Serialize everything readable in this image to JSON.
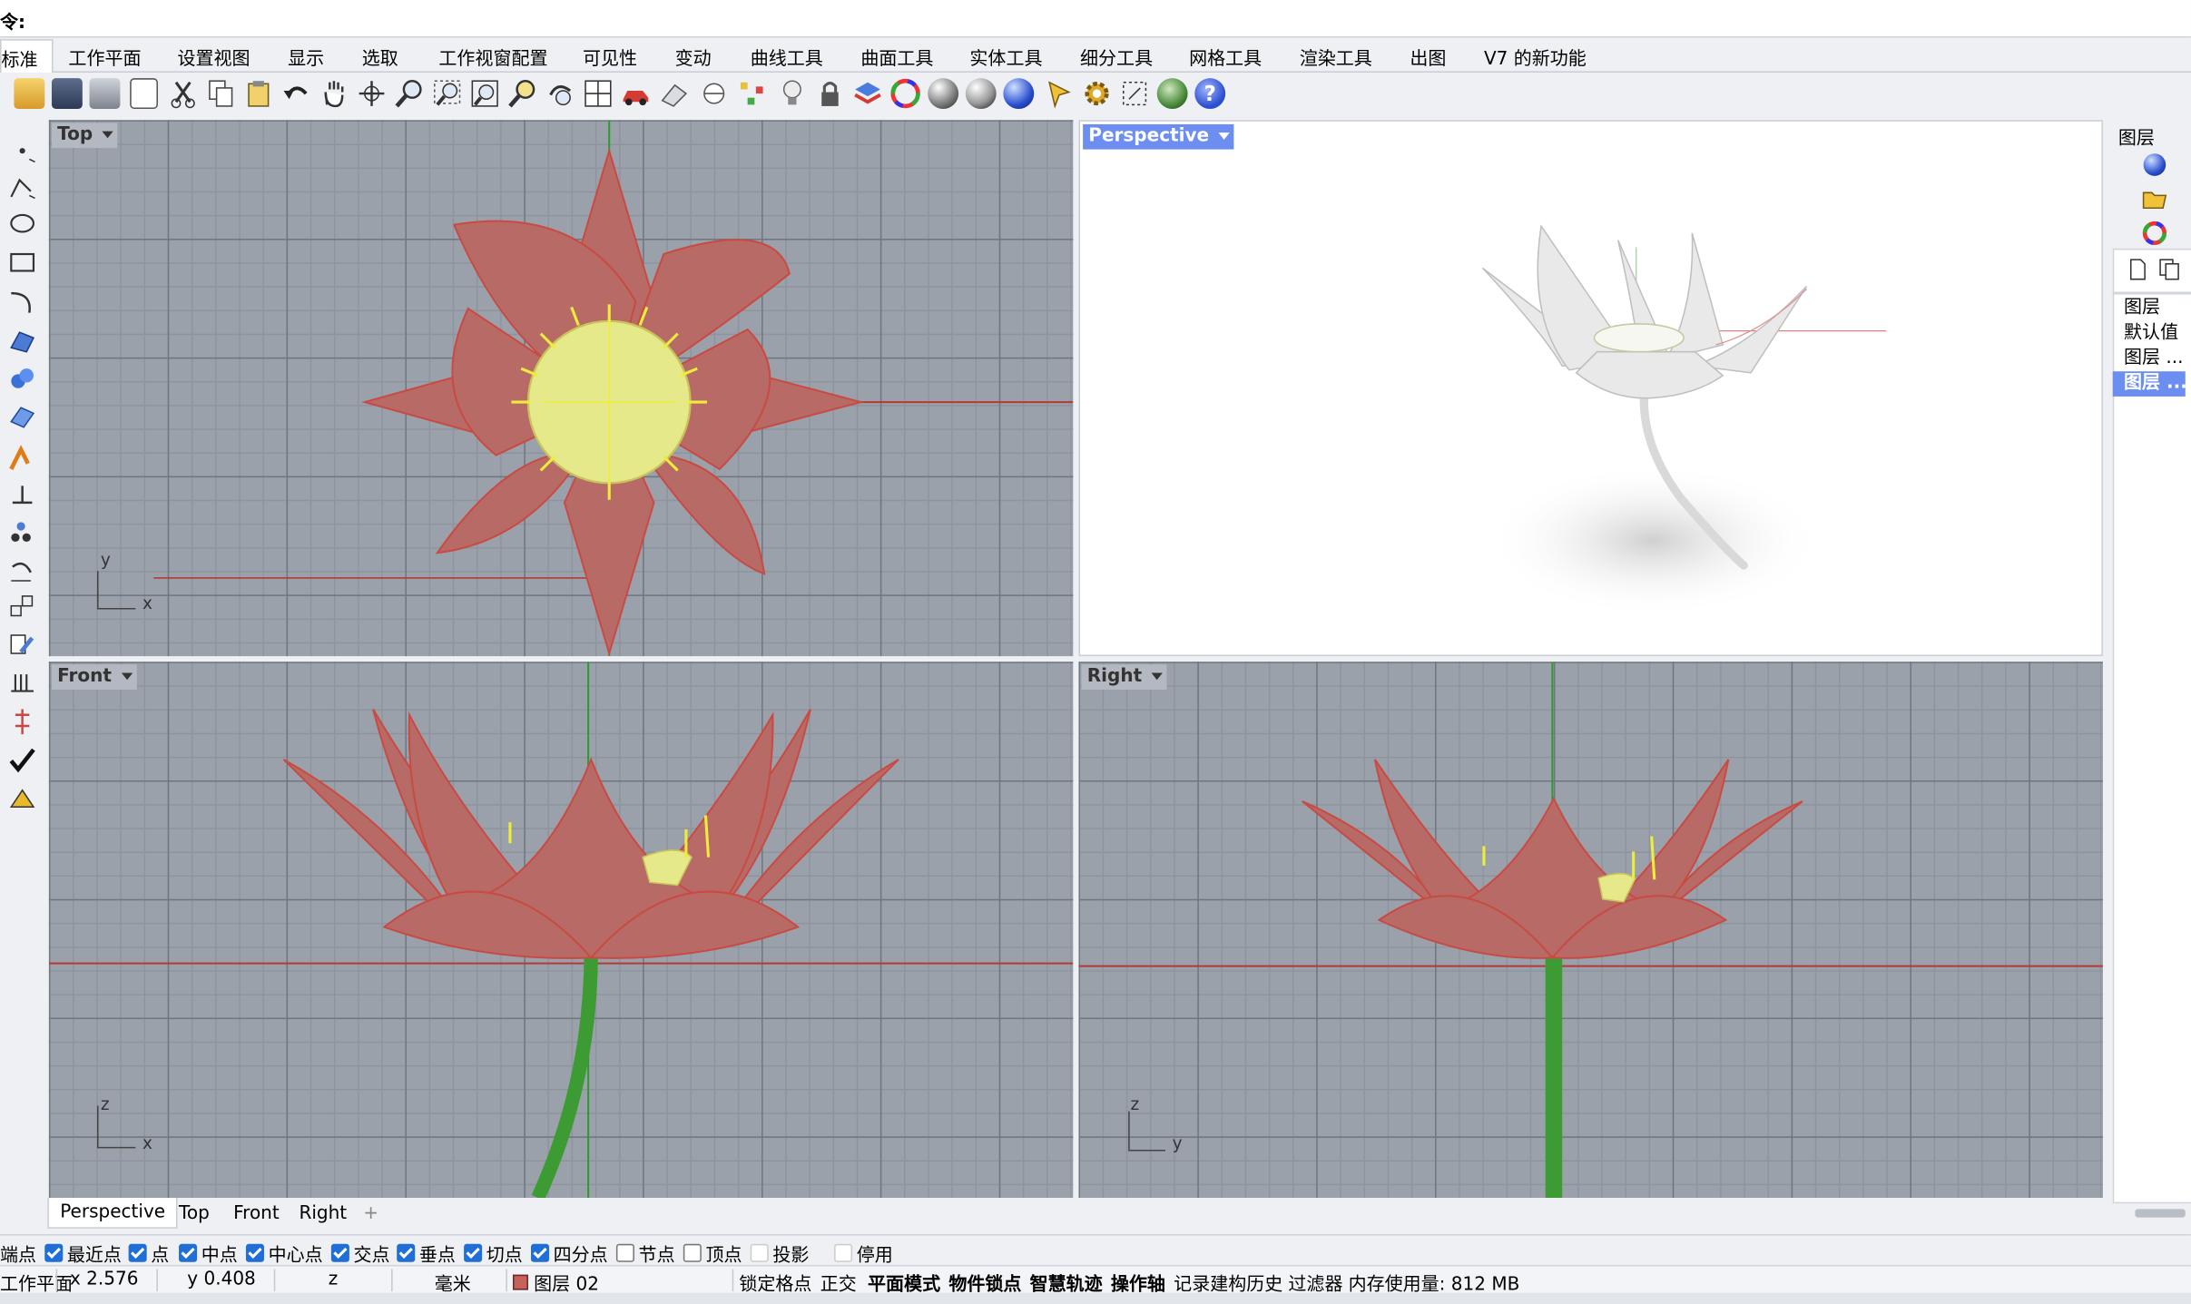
{
  "command": {
    "prompt": "令:"
  },
  "menu_tabs": [
    {
      "label": "标准",
      "active": true
    },
    {
      "label": "工作平面"
    },
    {
      "label": "设置视图"
    },
    {
      "label": "显示"
    },
    {
      "label": "选取"
    },
    {
      "label": "工作视窗配置"
    },
    {
      "label": "可见性"
    },
    {
      "label": "变动"
    },
    {
      "label": "曲线工具"
    },
    {
      "label": "曲面工具"
    },
    {
      "label": "实体工具"
    },
    {
      "label": "细分工具"
    },
    {
      "label": "网格工具"
    },
    {
      "label": "渲染工具"
    },
    {
      "label": "出图"
    },
    {
      "label": "V7 的新功能"
    }
  ],
  "viewports": {
    "top": {
      "title": "Top",
      "axis_v": "y",
      "axis_h": "x"
    },
    "perspective": {
      "title": "Perspective"
    },
    "front": {
      "title": "Front",
      "axis_v": "z",
      "axis_h": "x"
    },
    "right": {
      "title": "Right",
      "axis_v": "z",
      "axis_h": "y"
    }
  },
  "viewport_tabs": [
    "Perspective",
    "Top",
    "Front",
    "Right"
  ],
  "snaps": [
    {
      "label": "端点",
      "on": true,
      "partial": true
    },
    {
      "label": "最近点",
      "on": true
    },
    {
      "label": "点",
      "on": true
    },
    {
      "label": "中点",
      "on": true
    },
    {
      "label": "中心点",
      "on": true
    },
    {
      "label": "交点",
      "on": true
    },
    {
      "label": "垂点",
      "on": true
    },
    {
      "label": "切点",
      "on": true
    },
    {
      "label": "四分点",
      "on": true
    },
    {
      "label": "节点",
      "on": false
    },
    {
      "label": "顶点",
      "on": false
    },
    {
      "label": "投影",
      "on": false
    },
    {
      "label": "停用",
      "on": false
    }
  ],
  "status": {
    "cplane": "工作平面",
    "x": "x 2.576",
    "y": "y 0.408",
    "z": "z",
    "unit": "毫米",
    "layer": "图层 02",
    "layer_color": "#c8605c",
    "grid_snap": "锁定格点",
    "ortho": "正交",
    "planar": "平面模式",
    "osnap": "物件锁点",
    "smarttrack": "智慧轨迹",
    "gumball": "操作轴",
    "history": "记录建构历史",
    "filter": "过滤器",
    "memory": "内存使用量: 812 MB"
  },
  "layers_panel": {
    "title": "图层",
    "items": [
      {
        "label": "图层",
        "selected": false
      },
      {
        "label": "默认值",
        "selected": false
      },
      {
        "label": "图层 ...",
        "selected": false
      },
      {
        "label": "图层 ...",
        "selected": true
      }
    ]
  },
  "colors": {
    "petal": "#b96a66",
    "petal_line": "#d14a40",
    "center": "#e8ea8c",
    "stem": "#3fa63a",
    "active_title": "#6b8ef0"
  }
}
